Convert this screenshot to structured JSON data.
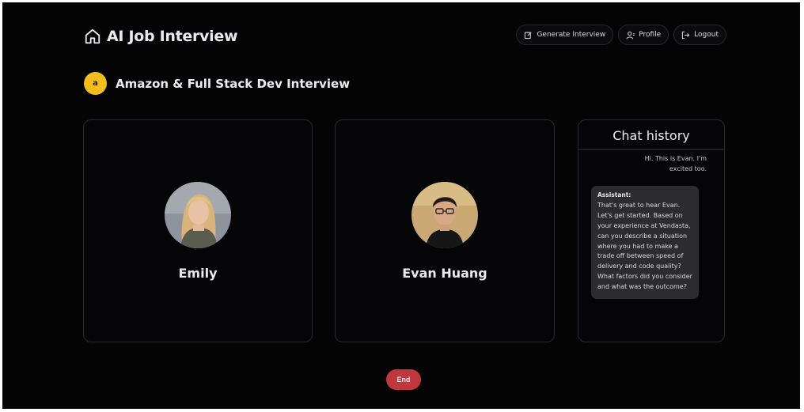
{
  "app": {
    "title": "AI Job Interview",
    "home_icon": "home-icon"
  },
  "nav": {
    "generate": {
      "label": "Generate Interview",
      "icon": "edit-icon"
    },
    "profile": {
      "label": "Profile",
      "icon": "user-icon"
    },
    "logout": {
      "label": "Logout",
      "icon": "logout-icon"
    }
  },
  "interview": {
    "logo_letter": "a",
    "logo_color": "#f2be1e",
    "title": "Amazon & Full Stack Dev Interview"
  },
  "participants": {
    "ai": {
      "name": "Emily"
    },
    "user": {
      "name": "Evan Huang"
    }
  },
  "chat": {
    "title": "Chat history",
    "user_message": "Hi. This is Evan. I'm excited too.",
    "assistant_label": "Assistant:",
    "assistant_message": "That's great to hear Evan. Let's get started. Based on your experience at Vendasta, can you describe a situation where you had to make a trade off between speed of delivery and code quality? What factors did you consider and what was the outcome?"
  },
  "controls": {
    "end_label": "End",
    "end_color": "#c0383f"
  }
}
